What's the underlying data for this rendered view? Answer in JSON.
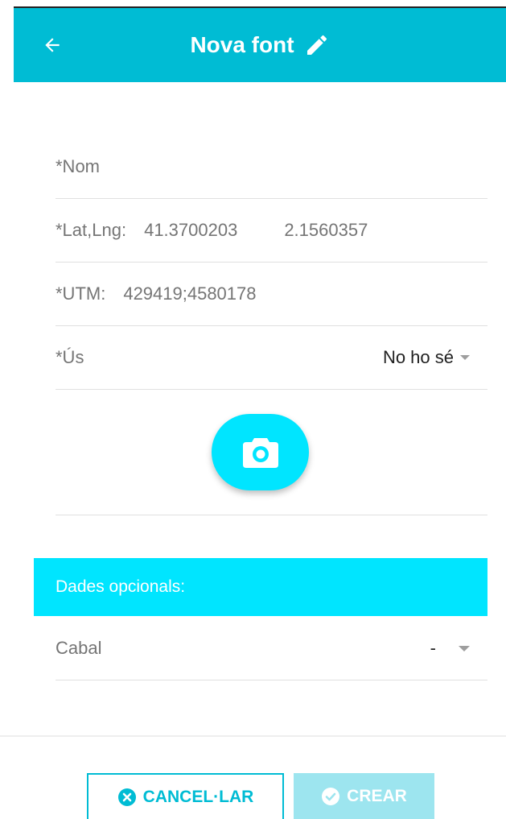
{
  "header": {
    "title": "Nova font",
    "back_icon": "arrow-left-icon",
    "edit_icon": "pencil-icon",
    "color": "#00bcd4"
  },
  "form": {
    "name": {
      "label": "*Nom",
      "value": ""
    },
    "latlng": {
      "label": "*Lat,Lng:",
      "lat": "41.3700203",
      "lng": "2.1560357"
    },
    "utm": {
      "label": "*UTM:",
      "value": "429419;4580178"
    },
    "us": {
      "label": "*Ús",
      "selected": "No ho sé"
    },
    "camera_icon": "camera-icon"
  },
  "optional": {
    "title": "Dades opcionals:",
    "color": "#00e5ff",
    "cabal": {
      "label": "Cabal",
      "selected": "-"
    }
  },
  "actions": {
    "cancel_label": "CANCEL·LAR",
    "create_label": "CREAR",
    "cancel_icon": "close-circle-icon",
    "create_icon": "check-circle-icon"
  }
}
